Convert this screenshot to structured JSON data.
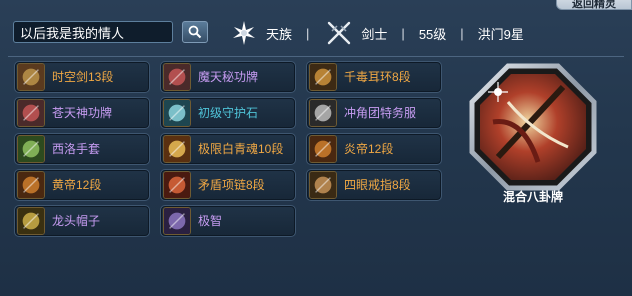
{
  "corner_button": "返回精灵",
  "search": {
    "value": "以后我是我的情人"
  },
  "profile": {
    "race": "天族",
    "class": "剑士",
    "level": "55级",
    "server": "洪门9星"
  },
  "equipment": [
    {
      "label": "时空剑13段",
      "color": "orange",
      "icon": "sword-icon"
    },
    {
      "label": "魔天秘功牌",
      "color": "purple",
      "icon": "badge-icon"
    },
    {
      "label": "千毒耳环8段",
      "color": "orange",
      "icon": "earring-icon"
    },
    {
      "label": "苍天神功牌",
      "color": "purple",
      "icon": "badge-icon"
    },
    {
      "label": "初级守护石",
      "color": "cyan",
      "icon": "stone-icon"
    },
    {
      "label": "冲角团特务服",
      "color": "purple",
      "icon": "outfit-icon"
    },
    {
      "label": "西洛手套",
      "color": "purple",
      "icon": "glove-icon"
    },
    {
      "label": "极限白青魂10段",
      "color": "orange",
      "icon": "soul-icon"
    },
    {
      "label": "炎帝12段",
      "color": "orange",
      "icon": "bracelet-icon"
    },
    {
      "label": "黄帝12段",
      "color": "orange",
      "icon": "bracelet-icon"
    },
    {
      "label": "矛盾项链8段",
      "color": "orange",
      "icon": "necklace-icon"
    },
    {
      "label": "四眼戒指8段",
      "color": "orange",
      "icon": "ring-icon"
    },
    {
      "label": "龙头帽子",
      "color": "purple",
      "icon": "helmet-icon"
    },
    {
      "label": "极智",
      "color": "purple",
      "icon": "pet-icon"
    }
  ],
  "bagua": {
    "label": "混合八卦牌"
  },
  "colors": {
    "orange": "#f0a844",
    "purple": "#c79cf2",
    "cyan": "#4fc3d8"
  }
}
